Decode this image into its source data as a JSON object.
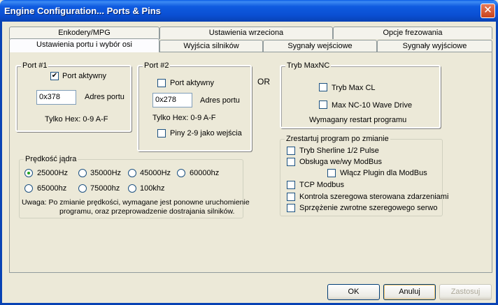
{
  "window": {
    "title": "Engine Configuration... Ports & Pins"
  },
  "tabs": {
    "row1": [
      "Enkodery/MPG",
      "Ustawienia wrzeciona",
      "Opcje frezowania"
    ],
    "row2": [
      "Ustawienia portu i wybór osi",
      "Wyjścia silników",
      "Sygnały wejściowe",
      "Sygnały wyjściowe"
    ]
  },
  "port1": {
    "legend": "Port #1",
    "enabled_label": "Port aktywny",
    "enabled_checked": true,
    "address_value": "0x378",
    "address_label": "Adres portu",
    "hex_hint": "Tylko Hex: 0-9 A-F"
  },
  "port2": {
    "legend": "Port #2",
    "enabled_label": "Port aktywny",
    "enabled_checked": false,
    "address_value": "0x278",
    "address_label": "Adres portu",
    "hex_hint": "Tylko Hex: 0-9 A-F",
    "pins_label": "Piny 2-9 jako wejścia",
    "pins_checked": false
  },
  "or_label": "OR",
  "maxnc": {
    "legend": "Tryb MaxNC",
    "maxcl_label": "Tryb Max CL",
    "wave_label": "Max NC-10 Wave Drive",
    "restart_note": "Wymagany restart programu"
  },
  "restart": {
    "legend": "Zrestartuj program po zmianie",
    "items": [
      "Tryb Sherline 1/2 Pulse",
      "Obsługa we/wy ModBus",
      "Włącz Plugin dla ModBus",
      "TCP Modbus",
      "Kontrola szeregowa sterowana zdarzeniami",
      "Sprzężenie zwrotne  szeregowego serwo"
    ]
  },
  "kernel": {
    "legend": "Prędkość jądra",
    "selected": "25000Hz",
    "options": [
      "25000Hz",
      "35000Hz",
      "45000Hz",
      "60000hz",
      "65000hz",
      "75000hz",
      "100khz"
    ],
    "note_line1": "Uwaga: Po zmianie prędkości, wymagane jest ponowne uruchomienie",
    "note_line2": "programu, oraz przeprowadzenie dostrajania silników."
  },
  "buttons": {
    "ok": "OK",
    "cancel": "Anuluj",
    "apply": "Zastosuj"
  },
  "icons": {
    "close": "close-icon",
    "check": "✔"
  },
  "colors": {
    "titlebar": "#0a4fd3",
    "face": "#ece9d8",
    "close": "#c9431b"
  }
}
